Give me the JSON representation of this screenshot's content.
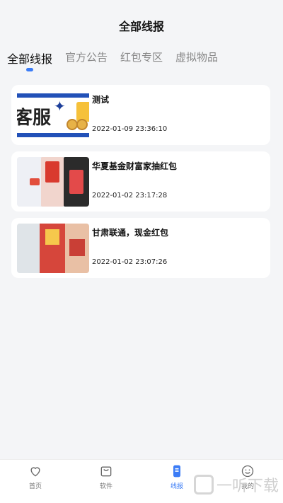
{
  "header": {
    "title": "全部线报"
  },
  "tabs": [
    {
      "label": "全部线报",
      "active": true
    },
    {
      "label": "官方公告",
      "active": false
    },
    {
      "label": "红包专区",
      "active": false
    },
    {
      "label": "虚拟物品",
      "active": false
    }
  ],
  "posts": [
    {
      "title": "测试",
      "time": "2022-01-09 23:36:10",
      "thumb_text": "客服"
    },
    {
      "title": "华夏基金财富家抽红包",
      "time": "2022-01-02 23:17:28"
    },
    {
      "title": "甘肃联通，现金红包",
      "time": "2022-01-02 23:07:26"
    }
  ],
  "nav": [
    {
      "label": "首页",
      "icon": "heart-icon"
    },
    {
      "label": "软件",
      "icon": "bag-icon"
    },
    {
      "label": "线报",
      "icon": "news-icon",
      "active": true
    },
    {
      "label": "我的",
      "icon": "smile-icon"
    }
  ],
  "watermark": {
    "text": "一听下载"
  },
  "colors": {
    "accent": "#3b7cf6",
    "background": "#f4f5f7"
  }
}
